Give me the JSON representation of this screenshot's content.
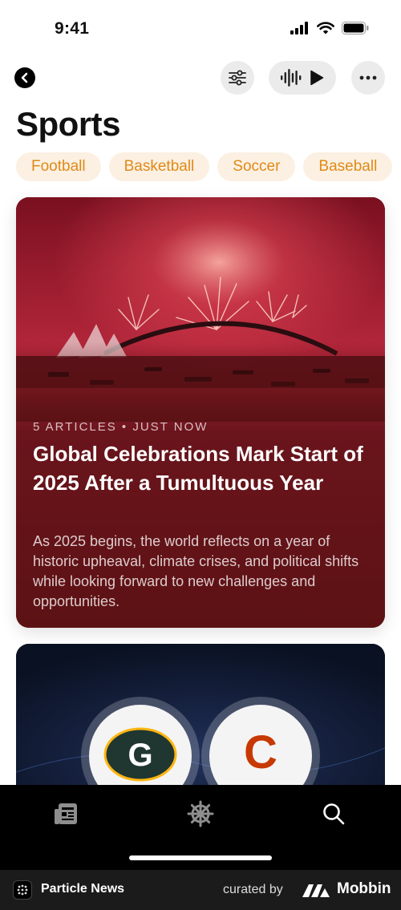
{
  "status_bar": {
    "time": "9:41"
  },
  "header": {
    "title": "Sports"
  },
  "categories": [
    "Football",
    "Basketball",
    "Soccer",
    "Baseball"
  ],
  "featured": {
    "meta": "5 ARTICLES • JUST NOW",
    "headline": "Global Celebrations Mark Start of 2025 After a Tumultuous Year",
    "summary": "As 2025 begins, the world reflects on a year of historic upheaval, climate crises, and political shifts while looking forward to new challenges and opportunities."
  },
  "footer": {
    "app_name": "Particle News",
    "curated_label": "curated by",
    "brand": "Mobbin"
  },
  "colors": {
    "accent": "#e08a17",
    "chip_bg": "#fbf0e2",
    "card_bg": "#5c1214",
    "tabbar_bg": "#000000"
  }
}
